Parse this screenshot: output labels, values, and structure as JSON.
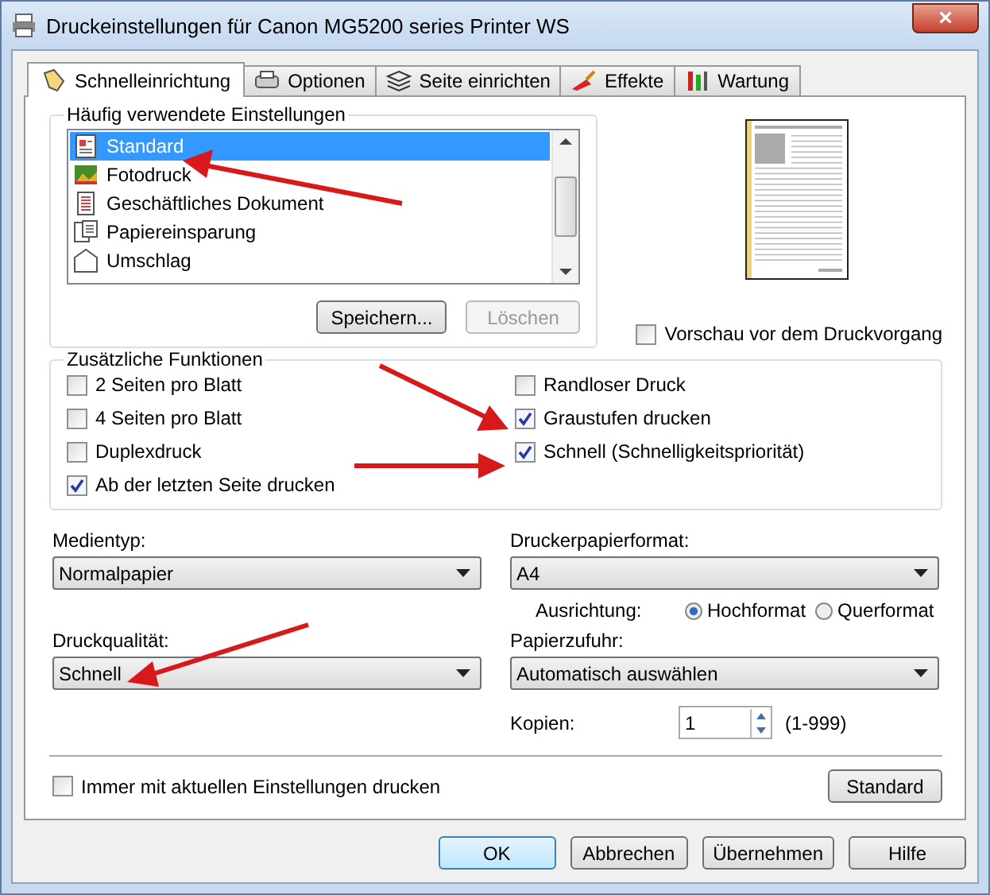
{
  "window": {
    "title": "Druckeinstellungen für Canon MG5200 series Printer WS",
    "close": "×"
  },
  "tabs": [
    {
      "label": "Schnelleinrichtung",
      "selected": true
    },
    {
      "label": "Optionen",
      "selected": false
    },
    {
      "label": "Seite einrichten",
      "selected": false
    },
    {
      "label": "Effekte",
      "selected": false
    },
    {
      "label": "Wartung",
      "selected": false
    }
  ],
  "presets": {
    "title": "Häufig verwendete Einstellungen",
    "items": [
      {
        "label": "Standard",
        "selected": true
      },
      {
        "label": "Fotodruck",
        "selected": false
      },
      {
        "label": "Geschäftliches Dokument",
        "selected": false
      },
      {
        "label": "Papiereinsparung",
        "selected": false
      },
      {
        "label": "Umschlag",
        "selected": false
      }
    ],
    "buttons": [
      {
        "label": "Speichern...",
        "disabled": false
      },
      {
        "label": "Löschen",
        "disabled": true
      }
    ]
  },
  "preview_checkbox": {
    "label": "Vorschau vor dem Druckvorgang",
    "checked": false
  },
  "functions": {
    "title": "Zusätzliche Funktionen",
    "left": [
      {
        "label": "2 Seiten pro Blatt",
        "checked": false
      },
      {
        "label": "4 Seiten pro Blatt",
        "checked": false
      },
      {
        "label": "Duplexdruck",
        "checked": false
      },
      {
        "label": "Ab der letzten Seite drucken",
        "checked": true
      }
    ],
    "right": [
      {
        "label": "Randloser Druck",
        "checked": false
      },
      {
        "label": "Graustufen drucken",
        "checked": true
      },
      {
        "label": "Schnell (Schnelligkeitspriorität)",
        "checked": true
      }
    ]
  },
  "media_type": {
    "label": "Medientyp:",
    "value": "Normalpapier"
  },
  "paper_size": {
    "label": "Druckerpapierformat:",
    "value": "A4"
  },
  "orientation": {
    "label": "Ausrichtung:",
    "options": [
      {
        "label": "Hochformat",
        "selected": true
      },
      {
        "label": "Querformat",
        "selected": false
      }
    ]
  },
  "print_quality": {
    "label": "Druckqualität:",
    "value": "Schnell"
  },
  "paper_source": {
    "label": "Papierzufuhr:",
    "value": "Automatisch auswählen"
  },
  "copies": {
    "label": "Kopien:",
    "value": "1",
    "range": "(1-999)"
  },
  "always_checkbox": {
    "label": "Immer mit aktuellen Einstellungen drucken",
    "checked": false
  },
  "defaults_button": "Standard",
  "footer_buttons": [
    {
      "label": "OK",
      "default": true
    },
    {
      "label": "Abbrechen",
      "default": false
    },
    {
      "label": "Übernehmen",
      "default": false
    },
    {
      "label": "Hilfe",
      "default": false
    }
  ]
}
